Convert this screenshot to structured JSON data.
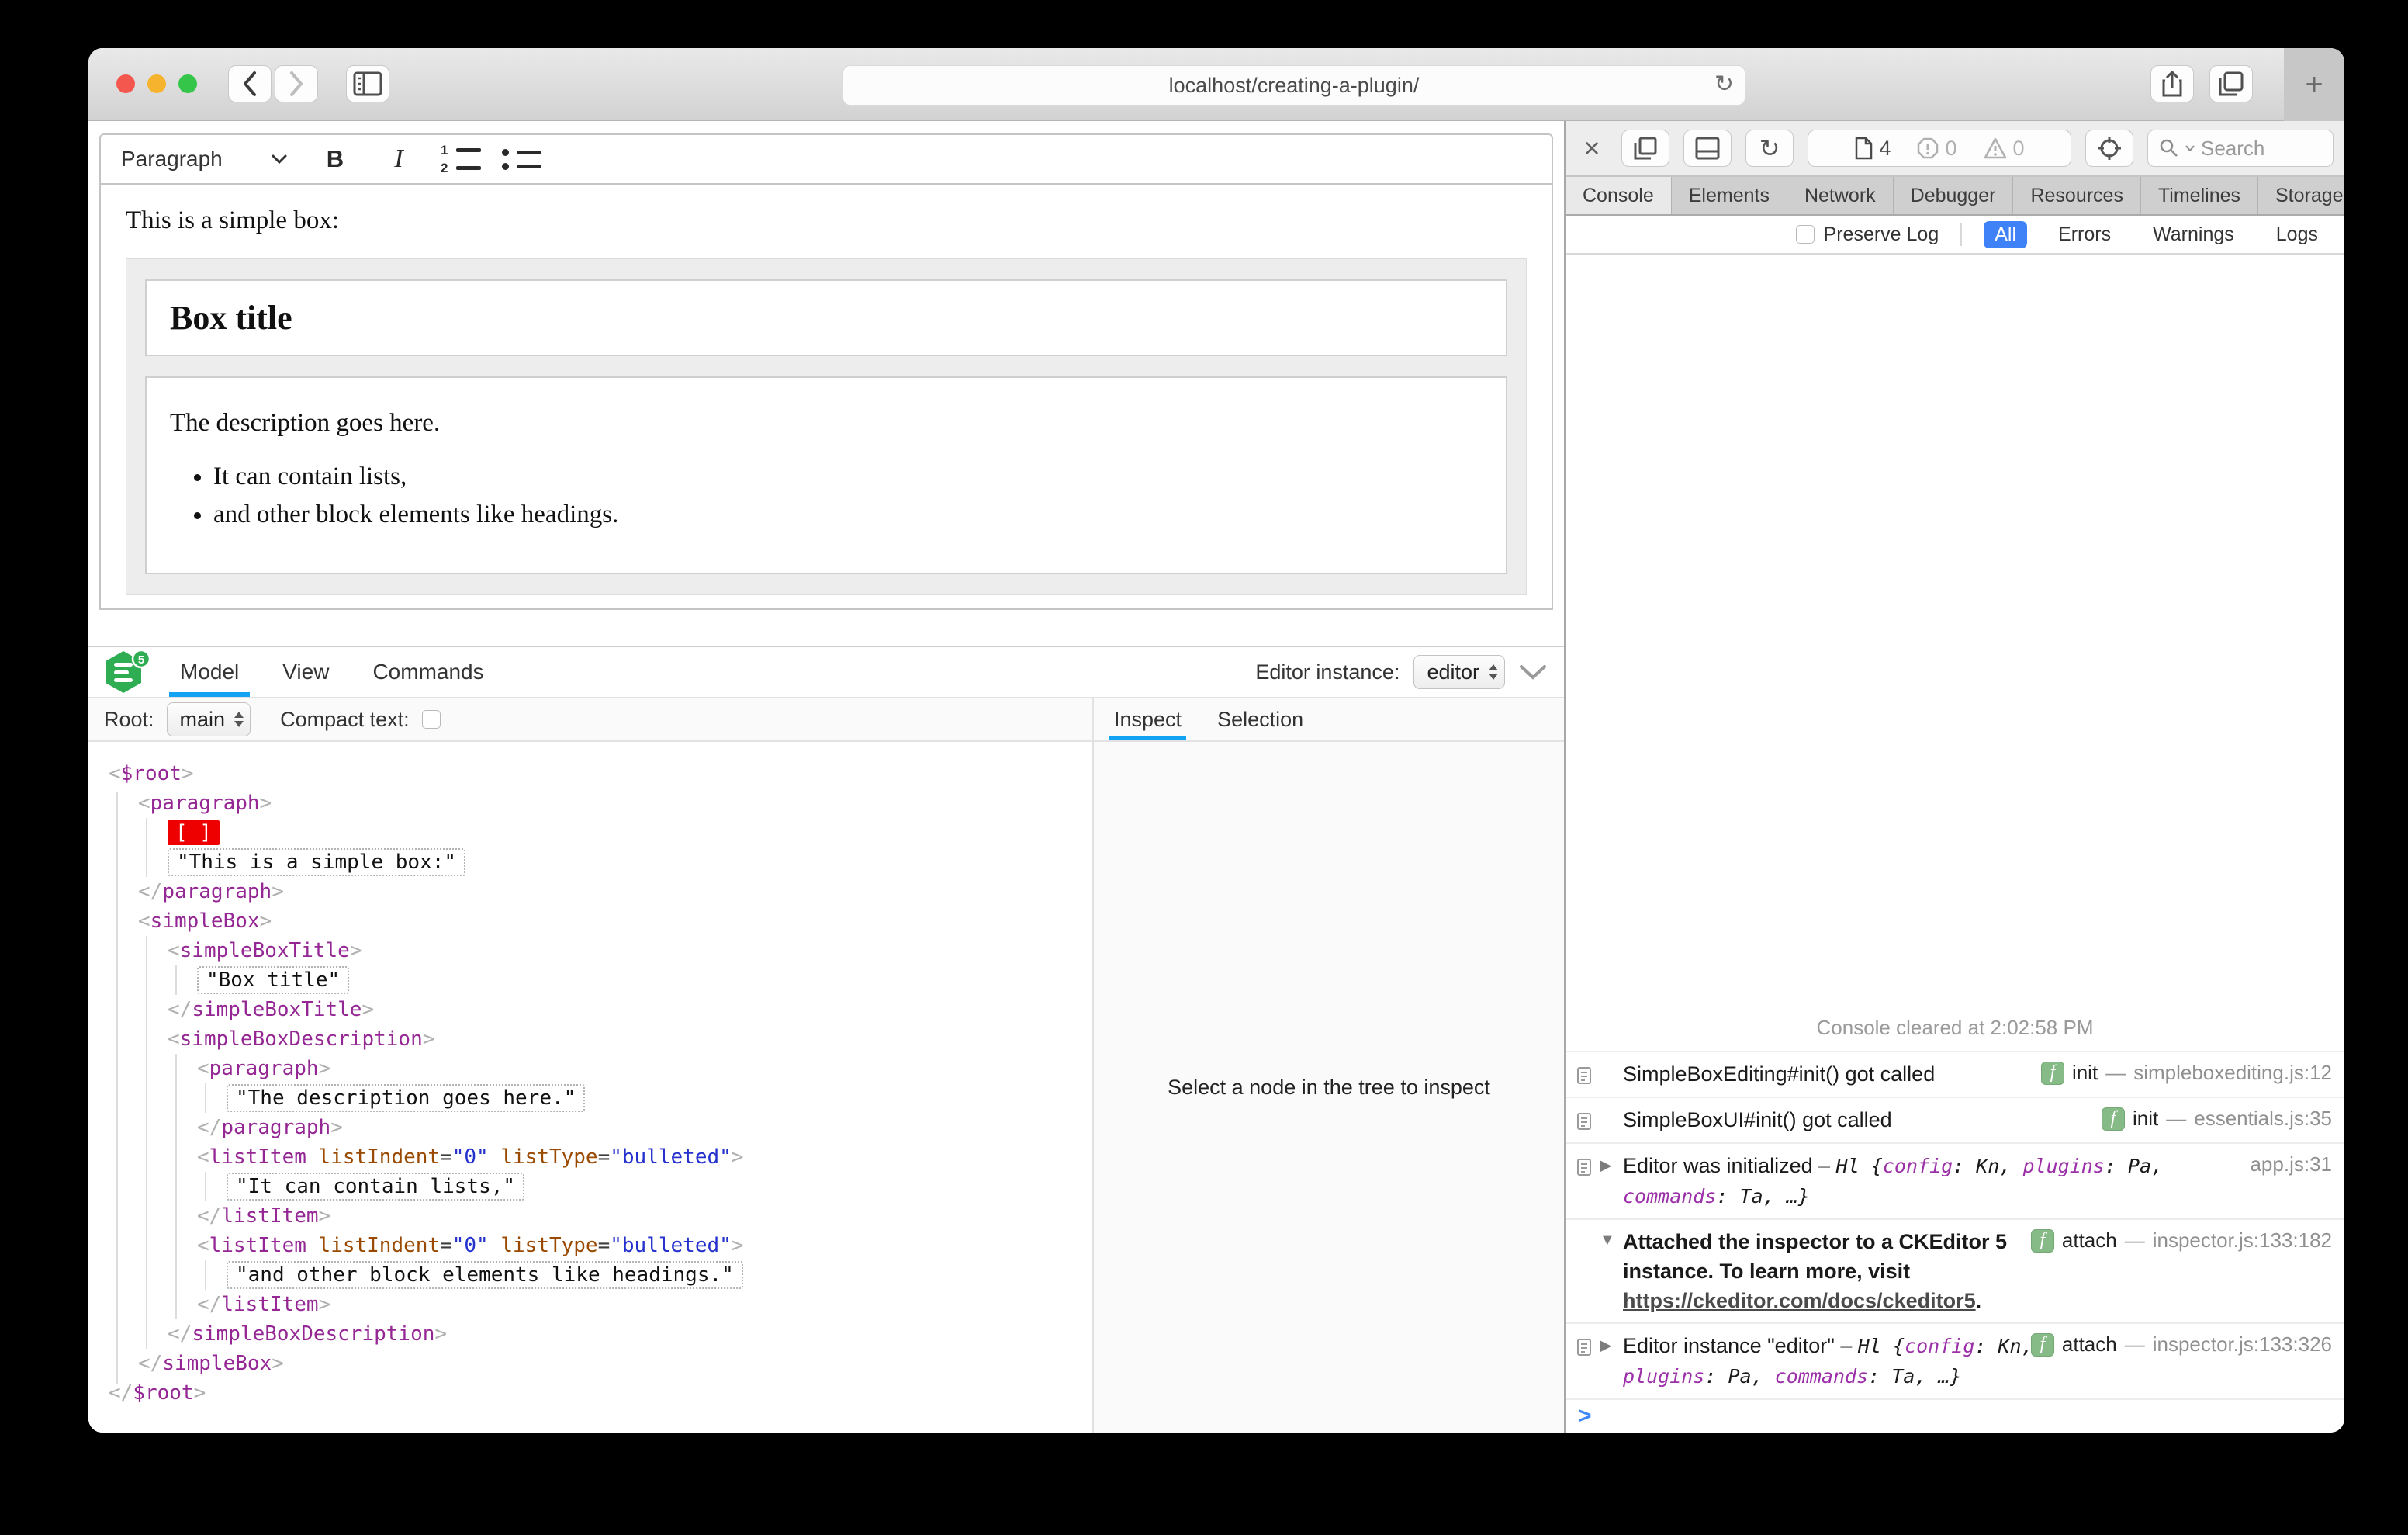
{
  "browser": {
    "url": "localhost/creating-a-plugin/",
    "new_tab_label": "+"
  },
  "editor": {
    "toolbar": {
      "style_dropdown": "Paragraph",
      "bold": "B",
      "italic": "I"
    },
    "content": {
      "intro": "This is a simple box:",
      "title": "Box title",
      "description": "The description goes here.",
      "list": [
        "It can contain lists,",
        "and other block elements like headings."
      ]
    }
  },
  "ck_inspector": {
    "logo_badge": "5",
    "tabs": [
      "Model",
      "View",
      "Commands"
    ],
    "active_tab": "Model",
    "editor_instance_label": "Editor instance:",
    "editor_instance_value": "editor",
    "root_label": "Root:",
    "root_value": "main",
    "compact_text_label": "Compact text:",
    "side_tabs": [
      "Inspect",
      "Selection"
    ],
    "side_active": "Inspect",
    "empty_panel_message": "Select a node in the tree to inspect",
    "accent_color": "#12a3f4",
    "tree": [
      {
        "i": 0,
        "t": "open",
        "name": "$root"
      },
      {
        "i": 1,
        "t": "open",
        "name": "paragraph"
      },
      {
        "i": 2,
        "t": "marker",
        "text": "[ ]"
      },
      {
        "i": 2,
        "t": "text",
        "text": "\"This is a simple box:\""
      },
      {
        "i": 1,
        "t": "close",
        "name": "paragraph"
      },
      {
        "i": 1,
        "t": "open",
        "name": "simpleBox"
      },
      {
        "i": 2,
        "t": "open",
        "name": "simpleBoxTitle"
      },
      {
        "i": 3,
        "t": "text",
        "text": "\"Box title\""
      },
      {
        "i": 2,
        "t": "close",
        "name": "simpleBoxTitle"
      },
      {
        "i": 2,
        "t": "open",
        "name": "simpleBoxDescription"
      },
      {
        "i": 3,
        "t": "open",
        "name": "paragraph"
      },
      {
        "i": 4,
        "t": "text",
        "text": "\"The description goes here.\""
      },
      {
        "i": 3,
        "t": "close",
        "name": "paragraph"
      },
      {
        "i": 3,
        "t": "open",
        "name": "listItem",
        "attrs": [
          [
            "listIndent",
            "0"
          ],
          [
            "listType",
            "bulleted"
          ]
        ]
      },
      {
        "i": 4,
        "t": "text",
        "text": "\"It can contain lists,\""
      },
      {
        "i": 3,
        "t": "close",
        "name": "listItem"
      },
      {
        "i": 3,
        "t": "open",
        "name": "listItem",
        "attrs": [
          [
            "listIndent",
            "0"
          ],
          [
            "listType",
            "bulleted"
          ]
        ]
      },
      {
        "i": 4,
        "t": "text",
        "text": "\"and other block elements like headings.\""
      },
      {
        "i": 3,
        "t": "close",
        "name": "listItem"
      },
      {
        "i": 2,
        "t": "close",
        "name": "simpleBoxDescription"
      },
      {
        "i": 1,
        "t": "close",
        "name": "simpleBox"
      },
      {
        "i": 0,
        "t": "close",
        "name": "$root"
      }
    ]
  },
  "web_inspector": {
    "page_count": "4",
    "error_count": "0",
    "warning_count": "0",
    "search_placeholder": "Search",
    "tabs": [
      "Console",
      "Elements",
      "Network",
      "Debugger",
      "Resources",
      "Timelines",
      "Storage"
    ],
    "active_tab": "Console",
    "overflow_label": "»",
    "add_tab_label": "+",
    "preserve_log_label": "Preserve Log",
    "filters": [
      "All",
      "Errors",
      "Warnings",
      "Logs"
    ],
    "active_filter": "All",
    "filter_active_color": "#3f82f7",
    "cleared_message": "Console cleared at 2:02:58 PM",
    "prompt_char": ">",
    "rows": [
      {
        "kind": "log",
        "icon": true,
        "disc": "",
        "width": "narrowf",
        "segs": [
          {
            "s": "p",
            "t": "SimpleBoxEditing#init() got called"
          }
        ],
        "fn": "init",
        "loc": "simpleboxediting.js:12"
      },
      {
        "kind": "log",
        "icon": true,
        "disc": "",
        "width": "narrowf",
        "segs": [
          {
            "s": "p",
            "t": "SimpleBoxUI#init() got called"
          }
        ],
        "fn": "init",
        "loc": "essentials.js:35"
      },
      {
        "kind": "log",
        "icon": true,
        "disc": "▶",
        "width": "widef",
        "segs": [
          {
            "s": "p",
            "t": "Editor was initialized"
          },
          {
            "s": "d",
            "t": " – "
          },
          {
            "s": "m",
            "t": "Hl "
          },
          {
            "s": "m",
            "t": "{"
          },
          {
            "s": "k",
            "t": "config"
          },
          {
            "s": "m",
            "t": ": "
          },
          {
            "s": "v",
            "t": "Kn"
          },
          {
            "s": "m",
            "t": ", "
          },
          {
            "s": "k",
            "t": "plugins"
          },
          {
            "s": "m",
            "t": ": "
          },
          {
            "s": "v",
            "t": "Pa"
          },
          {
            "s": "m",
            "t": ", "
          },
          {
            "s": "k",
            "t": "commands"
          },
          {
            "s": "m",
            "t": ": "
          },
          {
            "s": "v",
            "t": "Ta"
          },
          {
            "s": "m",
            "t": ", …}"
          }
        ],
        "fn": "",
        "loc": "app.js:31"
      },
      {
        "kind": "bold",
        "icon": false,
        "disc": "▼",
        "width": "narrowf",
        "segs": [
          {
            "s": "b",
            "t": "Attached the inspector to a CKEditor 5 instance. To learn more, visit "
          },
          {
            "s": "lnk",
            "t": "https://ckeditor.com/docs/ckeditor5"
          },
          {
            "s": "b",
            "t": "."
          }
        ],
        "fn": "attach",
        "loc": "inspector.js:133:182"
      },
      {
        "kind": "log",
        "icon": true,
        "disc": "▶",
        "width": "narrowf",
        "segs": [
          {
            "s": "p",
            "t": "Editor instance \"editor\""
          },
          {
            "s": "d",
            "t": " – "
          },
          {
            "s": "m",
            "t": "Hl "
          },
          {
            "s": "m",
            "t": "{"
          },
          {
            "s": "k",
            "t": "config"
          },
          {
            "s": "m",
            "t": ": "
          },
          {
            "s": "v",
            "t": "Kn"
          },
          {
            "s": "m",
            "t": ", "
          },
          {
            "s": "k",
            "t": "plugins"
          },
          {
            "s": "m",
            "t": ": "
          },
          {
            "s": "v",
            "t": "Pa"
          },
          {
            "s": "m",
            "t": ", "
          },
          {
            "s": "k",
            "t": "commands"
          },
          {
            "s": "m",
            "t": ": "
          },
          {
            "s": "v",
            "t": "Ta"
          },
          {
            "s": "m",
            "t": ", …}"
          }
        ],
        "fn": "attach",
        "loc": "inspector.js:133:326"
      }
    ]
  }
}
